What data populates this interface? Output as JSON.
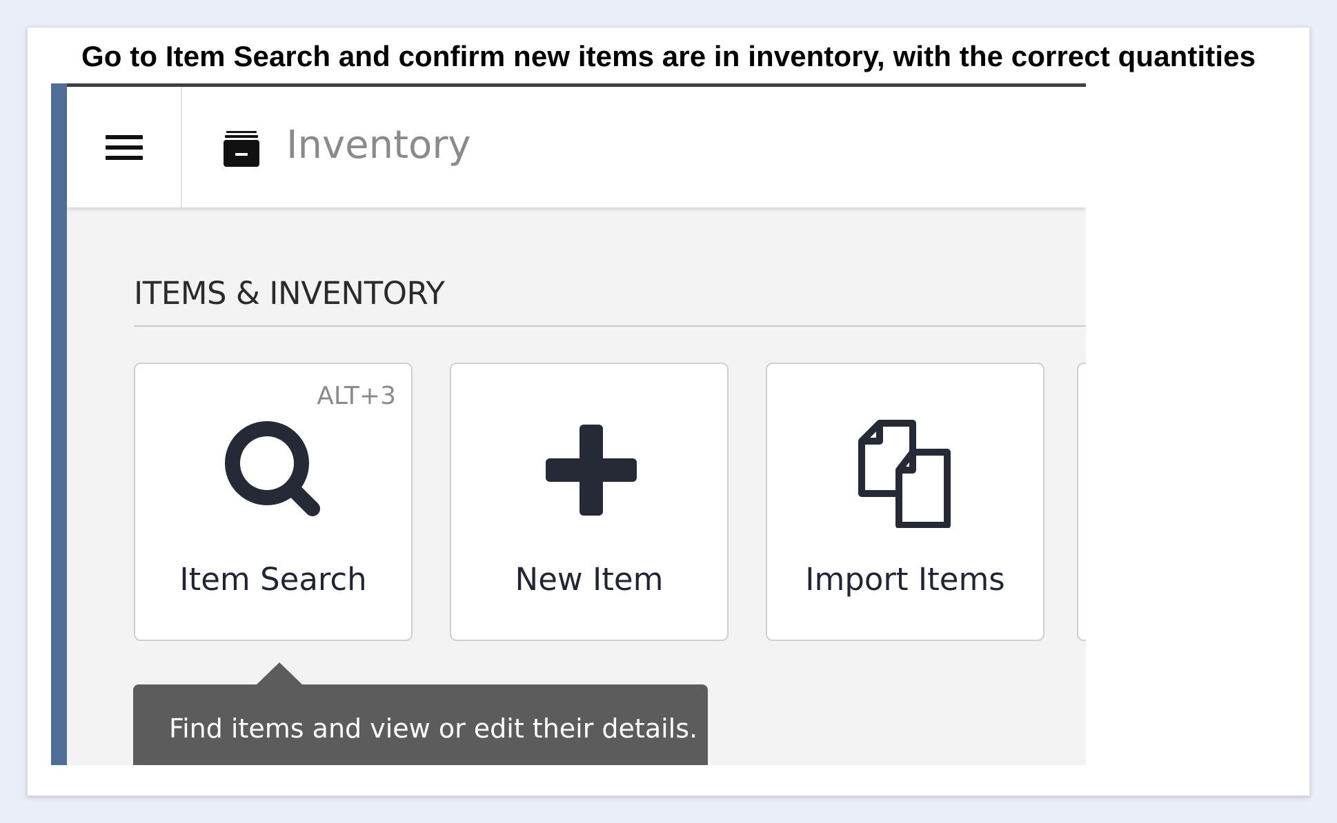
{
  "instruction": "Go to Item Search and confirm new items are in inventory, with the correct quantities",
  "header": {
    "menu_icon": "hamburger-menu-icon",
    "app_icon": "archive-box-icon",
    "title": "Inventory"
  },
  "section": {
    "title": "ITEMS & INVENTORY"
  },
  "tiles": [
    {
      "label": "Item Search",
      "shortcut": "ALT+3",
      "icon": "search-icon"
    },
    {
      "label": "New Item",
      "icon": "plus-icon"
    },
    {
      "label": "Import Items",
      "icon": "documents-icon"
    }
  ],
  "tooltip": {
    "text": "Find items and view or edit their details."
  },
  "colors": {
    "accent_bar": "#4f6f9a",
    "icon_dark": "#252a36",
    "tooltip_bg": "#5c5c5c"
  }
}
